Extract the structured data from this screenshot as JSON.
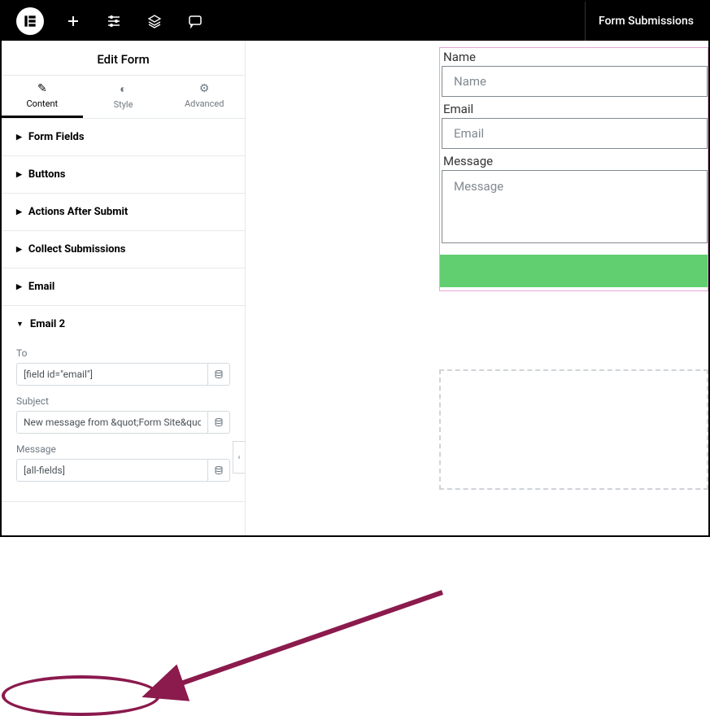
{
  "topbar": {
    "form_submissions": "Form Submissions"
  },
  "sidebar": {
    "title": "Edit Form",
    "tabs": {
      "content": "Content",
      "style": "Style",
      "advanced": "Advanced"
    },
    "sections": {
      "form_fields": "Form Fields",
      "buttons": "Buttons",
      "actions_after_submit": "Actions After Submit",
      "collect_submissions": "Collect Submissions",
      "email": "Email",
      "email2": "Email 2"
    },
    "email2_fields": {
      "to_label": "To",
      "to_value": "[field id=\"email\"]",
      "subject_label": "Subject",
      "subject_value": "New message from &quot;Form Site&quo",
      "message_label": "Message",
      "message_value": "[all-fields]"
    }
  },
  "form": {
    "name_label": "Name",
    "name_placeholder": "Name",
    "email_label": "Email",
    "email_placeholder": "Email",
    "message_label": "Message",
    "message_placeholder": "Message"
  }
}
